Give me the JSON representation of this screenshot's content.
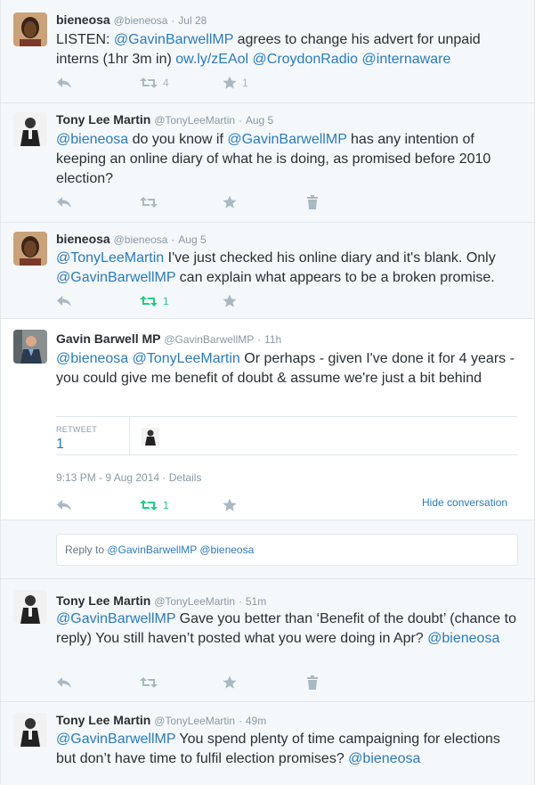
{
  "tweets": [
    {
      "fullname": "bieneosa",
      "username": "@bieneosa",
      "timestamp": "Jul 28",
      "text_parts": [
        {
          "t": "LISTEN: ",
          "link": false
        },
        {
          "t": "@GavinBarwellMP",
          "link": true
        },
        {
          "t": " agrees to change his advert for unpaid interns (1hr 3m in)  ",
          "link": false
        },
        {
          "t": "ow.ly/zEAol",
          "link": true
        },
        {
          "t": " ",
          "link": false
        },
        {
          "t": "@CroydonRadio",
          "link": true
        },
        {
          "t": " ",
          "link": false
        },
        {
          "t": "@internaware",
          "link": true
        }
      ],
      "retweets": "4",
      "favorites": "1"
    },
    {
      "fullname": "Tony Lee Martin",
      "username": "@TonyLeeMartin",
      "timestamp": "Aug 5",
      "text_parts": [
        {
          "t": "@bieneosa",
          "link": true
        },
        {
          "t": " do you know if ",
          "link": false
        },
        {
          "t": "@GavinBarwellMP",
          "link": true
        },
        {
          "t": " has any intention of keeping an online diary of what he is doing, as promised before 2010 election?",
          "link": false
        }
      ]
    },
    {
      "fullname": "bieneosa",
      "username": "@bieneosa",
      "timestamp": "Aug 5",
      "text_parts": [
        {
          "t": "@TonyLeeMartin",
          "link": true
        },
        {
          "t": " I've just checked his online diary and it's blank. Only ",
          "link": false
        },
        {
          "t": "@GavinBarwellMP",
          "link": true
        },
        {
          "t": " can explain what appears to be a broken promise.",
          "link": false
        }
      ],
      "retweets": "1"
    },
    {
      "fullname": "Gavin Barwell MP",
      "username": "@GavinBarwellMP",
      "timestamp": "11h",
      "text_parts": [
        {
          "t": "@bieneosa",
          "link": true
        },
        {
          "t": " ",
          "link": false
        },
        {
          "t": "@TonyLeeMartin",
          "link": true
        },
        {
          "t": " Or perhaps - given I've done it for 4 years - you could give me benefit of doubt & assume we're just a bit behind",
          "link": false
        }
      ],
      "retweets": "1",
      "stats_label": "RETWEET",
      "stats_value": "1",
      "meta": "9:13 PM - 9 Aug 2014 · Details",
      "hide_conversation": "Hide conversation"
    },
    {
      "fullname": "Tony Lee Martin",
      "username": "@TonyLeeMartin",
      "timestamp": "51m",
      "text_parts": [
        {
          "t": "@GavinBarwellMP",
          "link": true
        },
        {
          "t": " Gave you better than ‘Benefit of the doubt’ (chance to reply) You still haven’t posted what you were doing in Apr? ",
          "link": false
        },
        {
          "t": "@bieneosa",
          "link": true
        }
      ]
    },
    {
      "fullname": "Tony Lee Martin",
      "username": "@TonyLeeMartin",
      "timestamp": "49m",
      "text_parts": [
        {
          "t": "@GavinBarwellMP",
          "link": true
        },
        {
          "t": " You spend plenty of time campaigning for elections but don’t have time to fulfil election promises? ",
          "link": false
        },
        {
          "t": "@bieneosa",
          "link": true
        }
      ]
    }
  ],
  "reply": {
    "prefix": "Reply to ",
    "mention1": "@GavinBarwellMP",
    "mention2": "@bieneosa"
  },
  "colors": {
    "link": "#2b7bb9",
    "retweet_active": "#19cf86",
    "icon": "#aab8c2",
    "muted": "#8899a6"
  }
}
